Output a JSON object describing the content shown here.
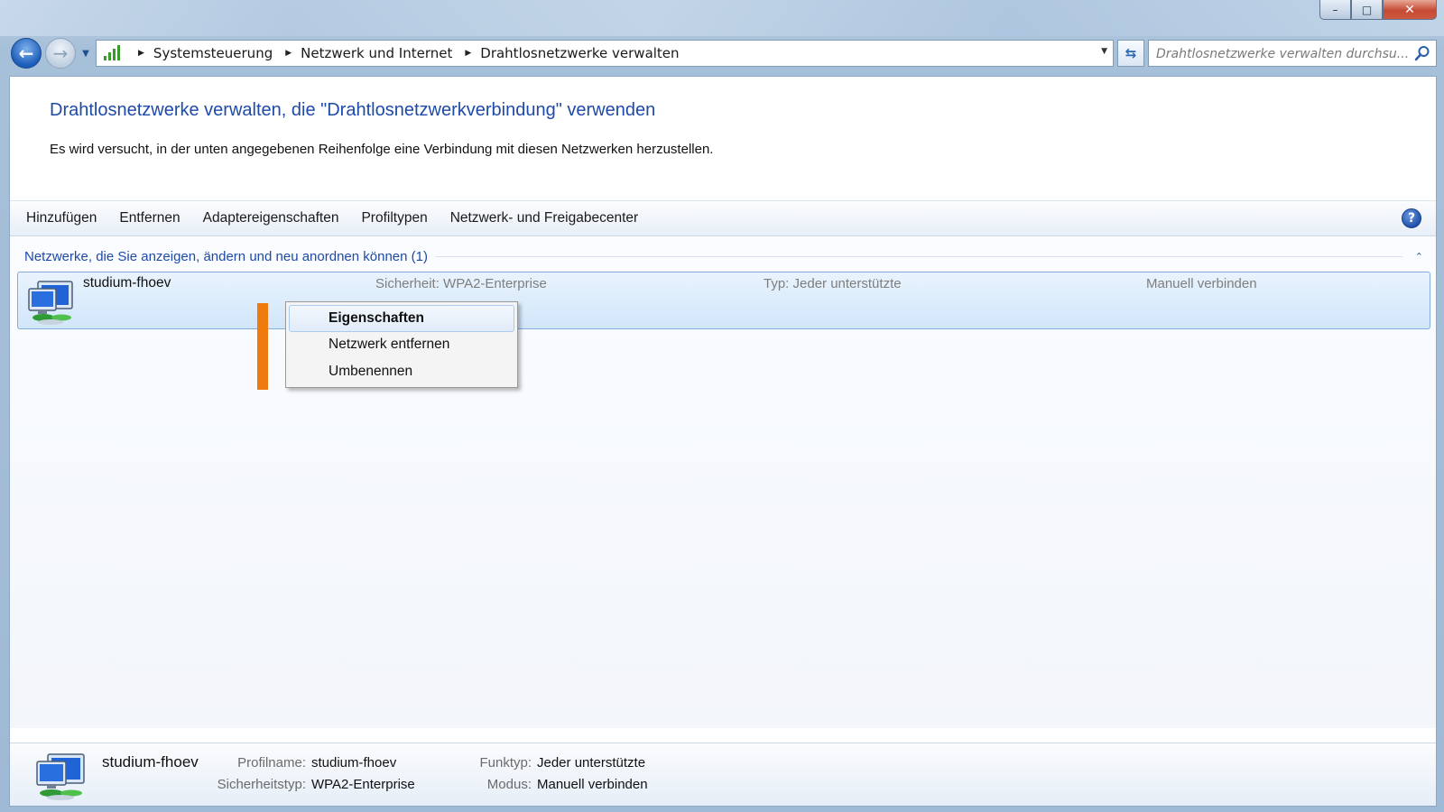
{
  "window": {
    "minimize_glyph": "–",
    "maximize_glyph": "□",
    "close_glyph": "✕"
  },
  "nav": {
    "breadcrumbs": [
      "Systemsteuerung",
      "Netzwerk und Internet",
      "Drahtlosnetzwerke verwalten"
    ],
    "search_placeholder": "Drahtlosnetzwerke verwalten durchsu..."
  },
  "page": {
    "title": "Drahtlosnetzwerke verwalten, die \"Drahtlosnetzwerkverbindung\" verwenden",
    "description": "Es wird versucht, in der unten angegebenen Reihenfolge eine Verbindung mit diesen Netzwerken herzustellen."
  },
  "toolbar": {
    "items": [
      "Hinzufügen",
      "Entfernen",
      "Adaptereigenschaften",
      "Profiltypen",
      "Netzwerk- und Freigabecenter"
    ],
    "help_glyph": "?"
  },
  "group": {
    "label": "Netzwerke, die Sie anzeigen, ändern und neu anordnen können (1)",
    "toggle_glyph": "⌃"
  },
  "network": {
    "name": "studium-fhoev",
    "security": "Sicherheit:  WPA2-Enterprise",
    "type": "Typ:  Jeder unterstützte",
    "mode": "Manuell verbinden"
  },
  "context_menu": {
    "items": [
      "Eigenschaften",
      "Netzwerk entfernen",
      "Umbenennen"
    ]
  },
  "details": {
    "name": "studium-fhoev",
    "profilname_label": "Profilname:",
    "profilname_value": "studium-fhoev",
    "sicherheitstyp_label": "Sicherheitstyp:",
    "sicherheitstyp_value": "WPA2-Enterprise",
    "funktyp_label": "Funktyp:",
    "funktyp_value": "Jeder unterstützte",
    "modus_label": "Modus:",
    "modus_value": "Manuell verbinden"
  },
  "colors": {
    "accent_blue": "#1e4aa8",
    "selection_border": "#84acdd",
    "marker_orange": "#ef7b0f"
  }
}
